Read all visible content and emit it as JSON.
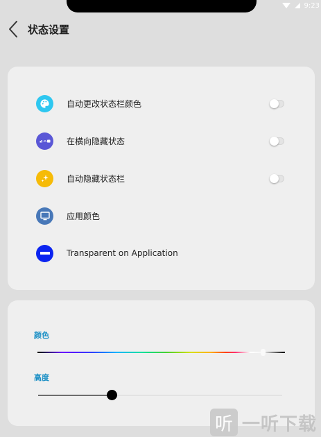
{
  "status_bar": {
    "time": "9:23"
  },
  "header": {
    "title": "状态设置"
  },
  "settings": {
    "items": [
      {
        "label": "自动更改状态栏颜色",
        "icon": "palette-icon",
        "icon_color": "#2ec7f0",
        "has_toggle": true,
        "toggle_on": false
      },
      {
        "label": "在横向隐藏状态",
        "icon": "landscape-status-icon",
        "icon_color": "#5a57d6",
        "has_toggle": true,
        "toggle_on": false
      },
      {
        "label": "自动隐藏状态栏",
        "icon": "sparkle-icon",
        "icon_color": "#f6bb08",
        "has_toggle": true,
        "toggle_on": false
      },
      {
        "label": "应用颜色",
        "icon": "monitor-icon",
        "icon_color": "#4878b8",
        "has_toggle": false
      },
      {
        "label": "Transparent on Application",
        "icon": "minus-circle-icon",
        "icon_color": "#0b24f0",
        "has_toggle": false
      }
    ]
  },
  "sliders": {
    "color_label": "颜色",
    "color_position": 0.91,
    "height_label": "高度",
    "height_value": 0.3
  },
  "watermark": {
    "glyph": "听",
    "text": "一听下载"
  }
}
